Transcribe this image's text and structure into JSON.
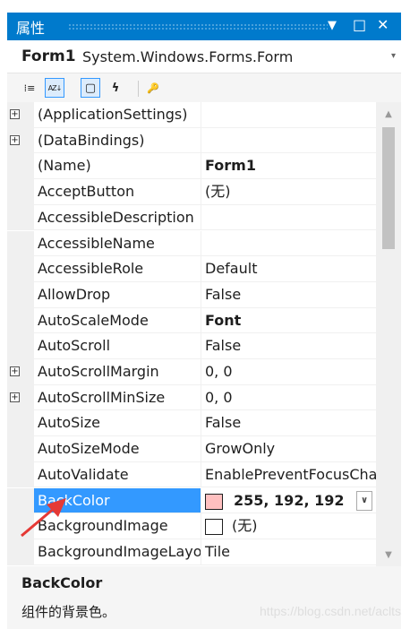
{
  "window": {
    "title": "属性",
    "menu_glyph": "▼",
    "maximize_glyph": "□",
    "close_glyph": "✕"
  },
  "selector": {
    "name": "Form1",
    "type": "System.Windows.Forms.Form",
    "dropdown_glyph": "▾"
  },
  "toolbar": {
    "categorized_glyph": "⁞≡",
    "alphabetical_glyph": "AZ↓",
    "properties_glyph": "▢",
    "events_glyph": "ϟ",
    "property_pages_glyph": "🔑"
  },
  "grid": {
    "rows": [
      {
        "name": "(ApplicationSettings)",
        "value": "",
        "expandable": true,
        "bold": false
      },
      {
        "name": "(DataBindings)",
        "value": "",
        "expandable": true,
        "bold": false
      },
      {
        "name": "(Name)",
        "value": "Form1",
        "expandable": false,
        "bold": true
      },
      {
        "name": "AcceptButton",
        "value": "(无)",
        "expandable": false,
        "bold": false
      },
      {
        "name": "AccessibleDescription",
        "value": "",
        "expandable": false,
        "bold": false
      },
      {
        "name": "AccessibleName",
        "value": "",
        "expandable": false,
        "bold": false
      },
      {
        "name": "AccessibleRole",
        "value": "Default",
        "expandable": false,
        "bold": false
      },
      {
        "name": "AllowDrop",
        "value": "False",
        "expandable": false,
        "bold": false
      },
      {
        "name": "AutoScaleMode",
        "value": "Font",
        "expandable": false,
        "bold": true
      },
      {
        "name": "AutoScroll",
        "value": "False",
        "expandable": false,
        "bold": false
      },
      {
        "name": "AutoScrollMargin",
        "value": "0, 0",
        "expandable": true,
        "bold": false
      },
      {
        "name": "AutoScrollMinSize",
        "value": "0, 0",
        "expandable": true,
        "bold": false
      },
      {
        "name": "AutoSize",
        "value": "False",
        "expandable": false,
        "bold": false
      },
      {
        "name": "AutoSizeMode",
        "value": "GrowOnly",
        "expandable": false,
        "bold": false
      },
      {
        "name": "AutoValidate",
        "value": "EnablePreventFocusChange",
        "expandable": false,
        "bold": false
      },
      {
        "name": "BackColor",
        "value": "255, 192, 192",
        "expandable": false,
        "bold": true,
        "selected": true,
        "swatch": "#ffc0c0",
        "has_dropdown": true
      },
      {
        "name": "BackgroundImage",
        "value": "(无)",
        "expandable": false,
        "bold": false,
        "swatch": "#ffffff"
      },
      {
        "name": "BackgroundImageLayout",
        "value": "Tile",
        "expandable": false,
        "bold": false
      }
    ],
    "expand_glyph": "+",
    "dropdown_glyph": "∨"
  },
  "scrollbar": {
    "up_glyph": "▲",
    "down_glyph": "▼"
  },
  "description": {
    "title": "BackColor",
    "text": "组件的背景色。",
    "watermark": "https://blog.csdn.net/aclts"
  },
  "colors": {
    "title_bar": "#007acc",
    "selection": "#3399ff",
    "annotation_arrow": "#e53935"
  }
}
